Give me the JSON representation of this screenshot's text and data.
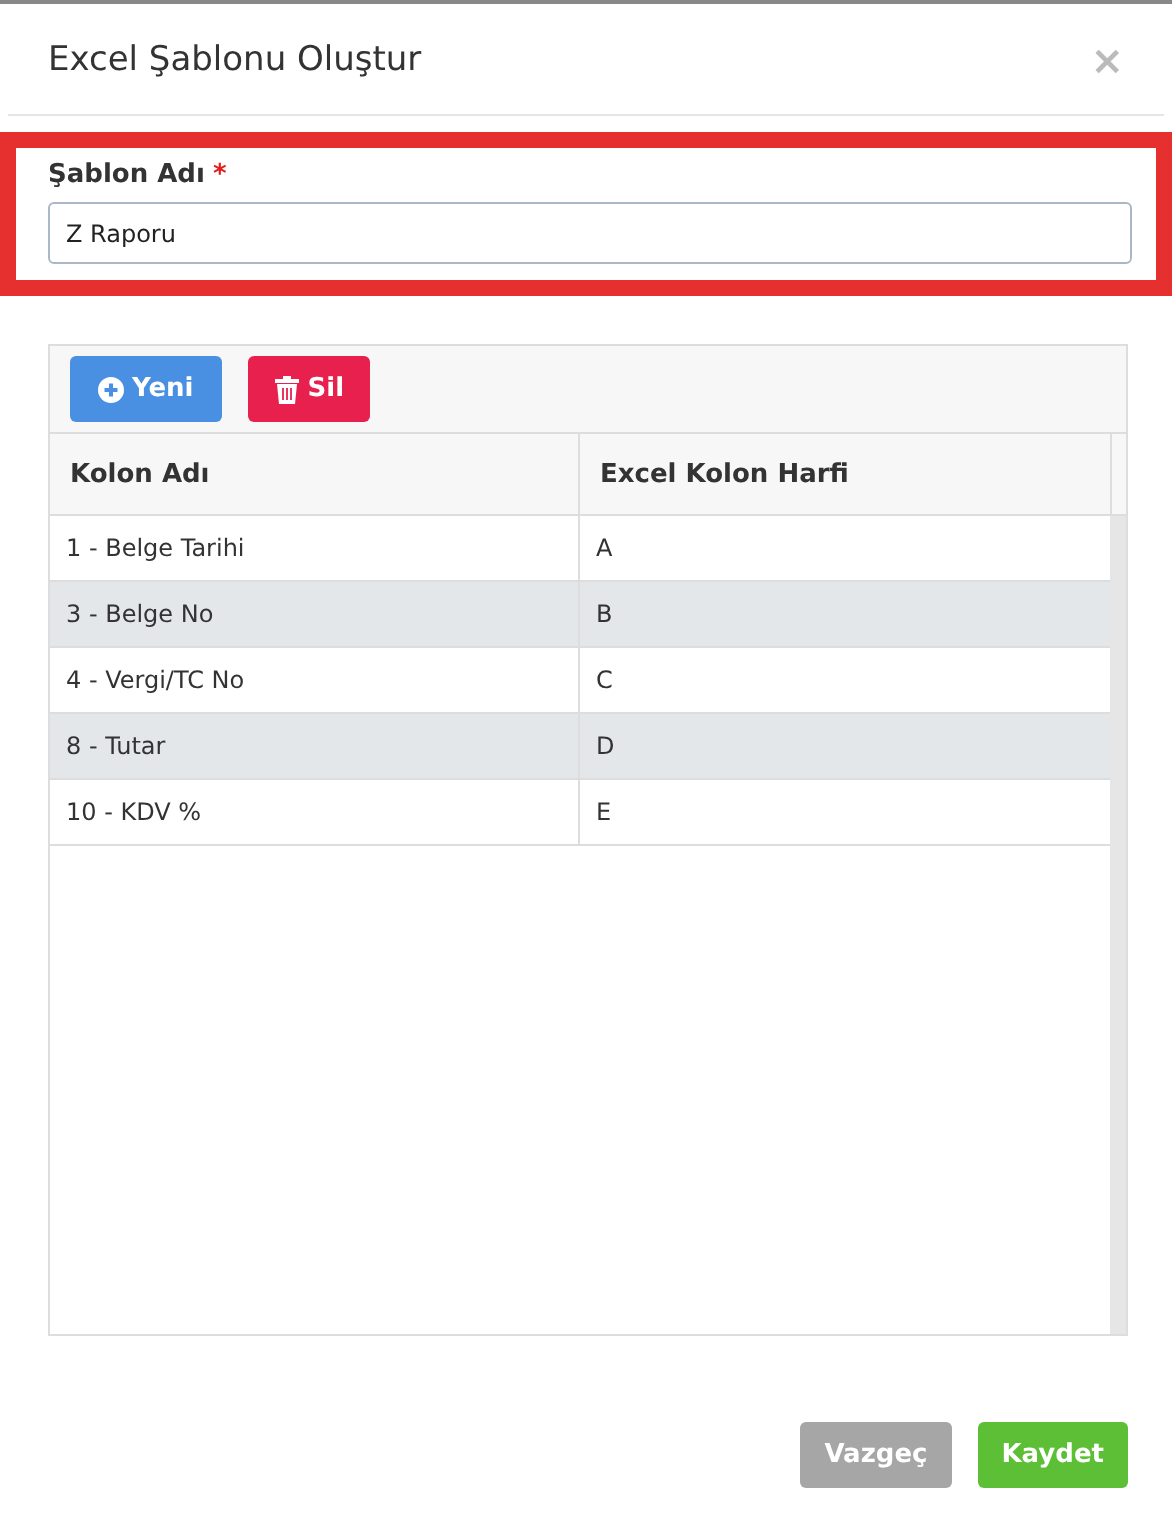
{
  "dialog": {
    "title": "Excel Şablonu Oluştur",
    "close": "×"
  },
  "template_field": {
    "label": "Şablon Adı",
    "required_mark": "*",
    "value": "Z Raporu",
    "highlighted": true
  },
  "toolbar": [
    {
      "kind": "add",
      "label": "Yeni"
    },
    {
      "kind": "delete",
      "label": "Sil"
    }
  ],
  "table": {
    "columns": [
      "Kolon Adı",
      "Excel Kolon Harfi"
    ],
    "rows": [
      [
        "1 - Belge Tarihi",
        "A"
      ],
      [
        "3 - Belge No",
        "B"
      ],
      [
        "4 - Vergi/TC No",
        "C"
      ],
      [
        "8 - Tutar",
        "D"
      ],
      [
        "10 - KDV %",
        "E"
      ]
    ]
  },
  "buttons": [
    {
      "kind": "cancel",
      "label": "Vazgeç"
    },
    {
      "kind": "save",
      "label": "Kaydet"
    }
  ]
}
